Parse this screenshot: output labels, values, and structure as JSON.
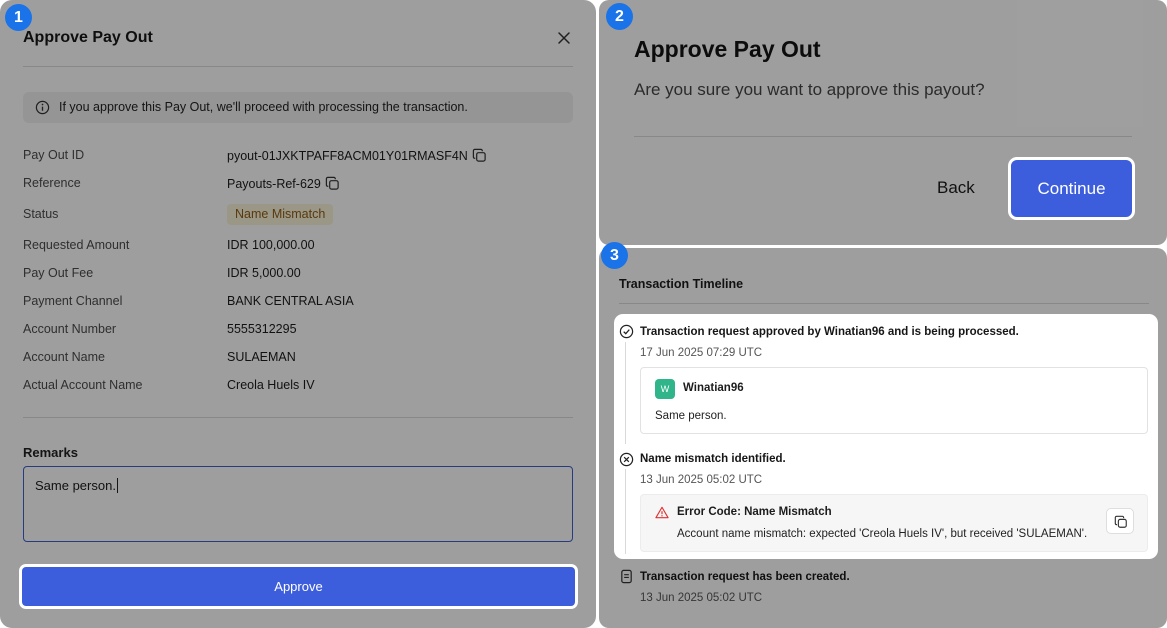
{
  "steps": [
    "1",
    "2",
    "3"
  ],
  "modal": {
    "title": "Approve Pay Out",
    "info": "If you approve this Pay Out, we'll proceed with processing the transaction.",
    "fields": {
      "payout_id": {
        "label": "Pay Out ID",
        "value": "pyout-01JXKTPAFF8ACM01Y01RMASF4N"
      },
      "reference": {
        "label": "Reference",
        "value": "Payouts-Ref-629"
      },
      "status": {
        "label": "Status",
        "value": "Name Mismatch"
      },
      "requested_amount": {
        "label": "Requested Amount",
        "value": "IDR 100,000.00"
      },
      "fee": {
        "label": "Pay Out Fee",
        "value": "IDR 5,000.00"
      },
      "channel": {
        "label": "Payment Channel",
        "value": "BANK CENTRAL ASIA"
      },
      "account_number": {
        "label": "Account Number",
        "value": "5555312295"
      },
      "account_name": {
        "label": "Account Name",
        "value": "SULAEMAN"
      },
      "actual_account_name": {
        "label": "Actual Account Name",
        "value": "Creola Huels IV"
      }
    },
    "remarks": {
      "label": "Remarks",
      "value": "Same person."
    },
    "approve_label": "Approve"
  },
  "confirm": {
    "title": "Approve Pay Out",
    "subtitle": "Are you sure you want to approve this payout?",
    "back_label": "Back",
    "continue_label": "Continue"
  },
  "timeline": {
    "title": "Transaction Timeline",
    "events": [
      {
        "icon": "check-circle-icon",
        "title": "Transaction request approved by Winatian96 and is being processed.",
        "time": "17 Jun 2025 07:29 UTC",
        "comment": {
          "avatar": "W",
          "user": "Winatian96",
          "text": "Same person."
        }
      },
      {
        "icon": "x-circle-icon",
        "title": "Name mismatch identified.",
        "time": "13 Jun 2025 05:02 UTC",
        "error": {
          "title": "Error Code: Name Mismatch",
          "text": "Account name mismatch: expected 'Creola Huels IV', but received 'SULAEMAN'."
        }
      },
      {
        "icon": "document-icon",
        "title": "Transaction request has been created.",
        "time": "13 Jun 2025 05:02 UTC"
      }
    ]
  },
  "colors": {
    "accent": "#3d5edc",
    "step_badge": "#1a73e8",
    "badge_bg": "#f3ecd3",
    "badge_text": "#8a5a15",
    "avatar": "#2fb589"
  }
}
